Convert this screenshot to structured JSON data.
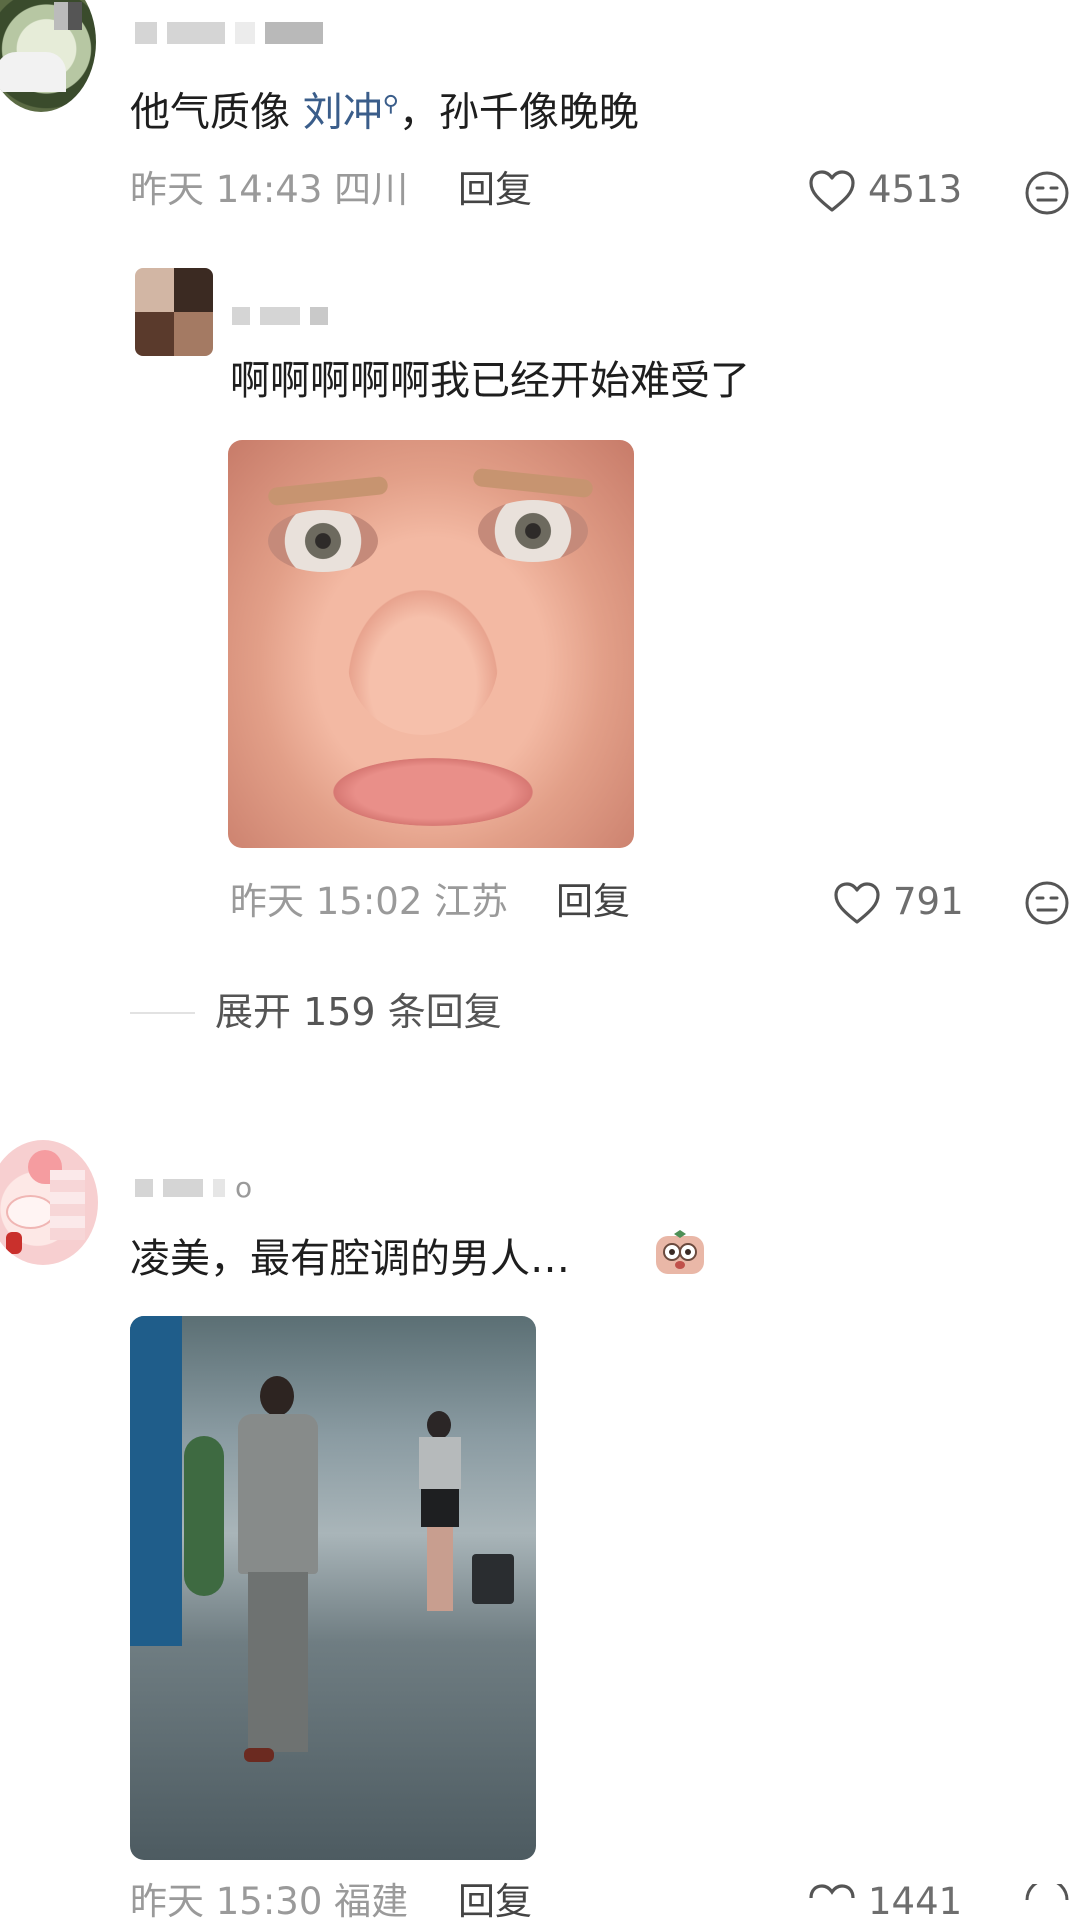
{
  "comments": [
    {
      "text_plain_1": "他气质像 ",
      "text_link": "刘冲",
      "text_plain_2": "，孙千像晚晚",
      "time": "昨天 14:43",
      "location": "四川",
      "reply_label": "回复",
      "likes": "4513"
    },
    {
      "text": "啊啊啊啊啊我已经开始难受了",
      "time": "昨天 15:02",
      "location": "江苏",
      "reply_label": "回复",
      "likes": "791"
    },
    {
      "text": "凌美，最有腔调的男人…",
      "name_fragment": "o",
      "time": "昨天 15:30",
      "location": "福建",
      "reply_label": "回复",
      "likes": "1441"
    }
  ],
  "expand_replies": "展开 159 条回复",
  "icons": {
    "link_search": "search-icon",
    "like": "heart-icon",
    "more": "neutral-face-icon"
  },
  "colors": {
    "link": "#3a5d8a",
    "meta": "#9a9a9a",
    "text": "#1e1e1e"
  }
}
